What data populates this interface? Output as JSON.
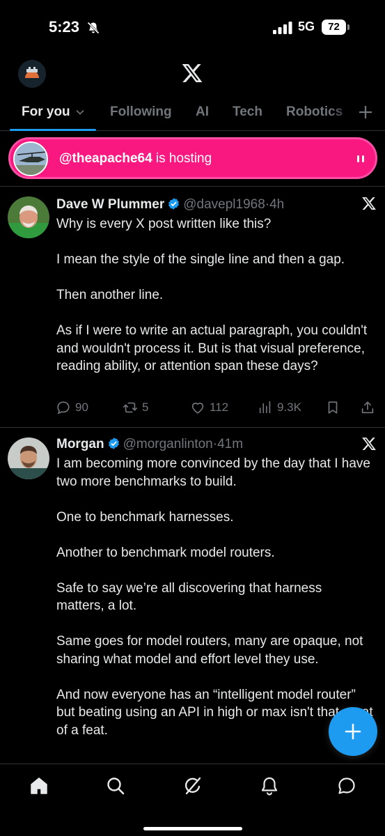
{
  "status_bar": {
    "time": "5:23",
    "network": "5G",
    "battery": "72"
  },
  "header": {
    "logo_icon": "x-logo-icon",
    "tabs": [
      {
        "label": "For you",
        "active": true
      },
      {
        "label": "Following",
        "active": false
      },
      {
        "label": "AI",
        "active": false
      },
      {
        "label": "Tech",
        "active": false
      },
      {
        "label": "Robotics",
        "active": false
      }
    ],
    "add_tab_icon": "plus-icon"
  },
  "space_banner": {
    "host": "@theapache64",
    "suffix": "is hosting",
    "color": "#f91880"
  },
  "posts": [
    {
      "name": "Dave W Plummer",
      "handle": "@davepl1968",
      "separator": "·",
      "time_ago": "4h",
      "paragraphs": [
        "Why is every X post written like this?",
        "I mean the style of the single line and then a gap.",
        "Then another line.",
        "As if I were to write an actual paragraph, you couldn't and wouldn't process it.  But is that visual preference, reading ability, or attention span these days?"
      ],
      "stats": {
        "replies": "90",
        "reposts": "5",
        "likes": "112",
        "views": "9.3K"
      }
    },
    {
      "name": "Morgan",
      "handle": "@morganlinton",
      "separator": "·",
      "time_ago": "41m",
      "paragraphs": [
        "I am becoming more convinced by the day that I have two more benchmarks to build.",
        "One to benchmark harnesses.",
        "Another to benchmark model routers.",
        "Safe to say we’re all discovering that harness matters, a lot.",
        "Same goes for model routers, many are opaque, not sharing what model and effort level they use.",
        "And now everyone has an “intelligent model router” but beating using an API in high or max isn't that great of a feat."
      ]
    }
  ],
  "colors": {
    "accent": "#1d9bf0",
    "muted_text": "#71767b",
    "divider": "#2f3336",
    "background": "#000000"
  },
  "bottom_nav": [
    "home-icon",
    "search-icon",
    "grok-icon",
    "notifications-icon",
    "messages-icon"
  ]
}
